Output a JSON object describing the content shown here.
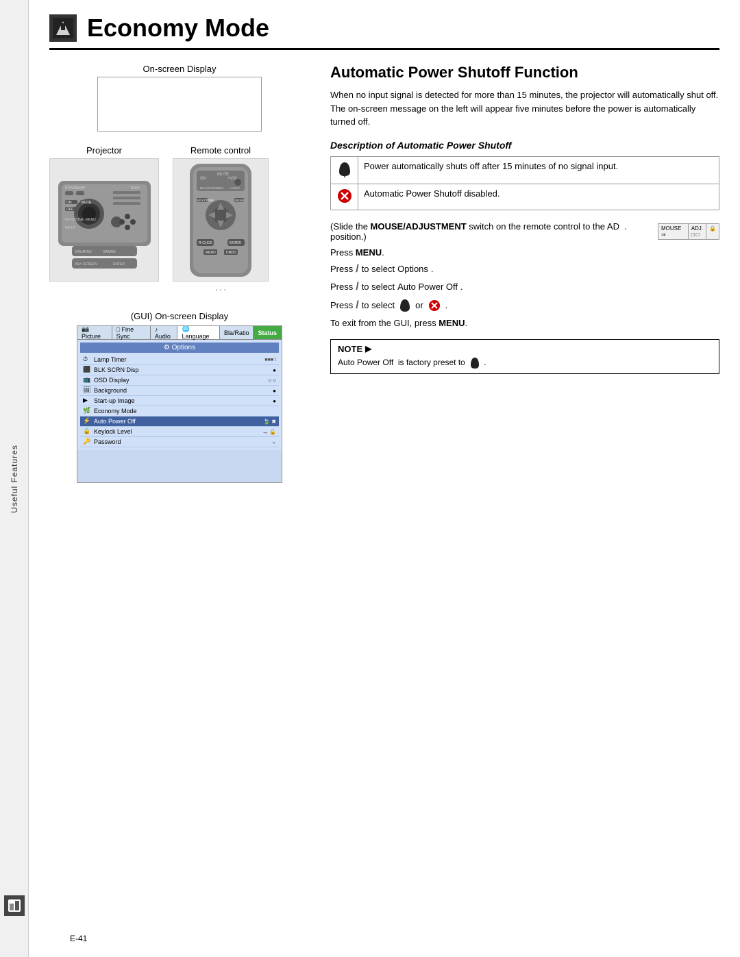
{
  "sidebar": {
    "label": "Useful Features",
    "icon": "★"
  },
  "header": {
    "title": "Economy Mode",
    "icon": "■"
  },
  "left": {
    "display_label": "On-screen Display",
    "projector_label": "Projector",
    "remote_label": "Remote control",
    "gui_label": "(GUI) On-screen Display",
    "gui_tabs": [
      "Picture",
      "Fine Sync",
      "Audio",
      "Language",
      "Bla/Ratio",
      "Status"
    ],
    "gui_menu_title": "Options",
    "gui_items": [
      {
        "icon": "lamp",
        "text": "Lamp Timer",
        "val": ""
      },
      {
        "icon": "flk",
        "text": "BLK SCRN Disp",
        "val": "●"
      },
      {
        "icon": "osd",
        "text": "OSD Display",
        "val": "○ ○"
      },
      {
        "icon": "bg",
        "text": "Background",
        "val": "●"
      },
      {
        "icon": "startup",
        "text": "Start-up Image",
        "val": "●"
      },
      {
        "icon": "econ",
        "text": "Economy Mode",
        "val": ""
      },
      {
        "icon": "autopow",
        "text": "Auto Power Off",
        "val": "selected",
        "selected": true
      },
      {
        "icon": "key",
        "text": "Keylock Level",
        "val": "→"
      },
      {
        "icon": "pwd",
        "text": "Password",
        "val": "→"
      }
    ]
  },
  "right": {
    "section_title": "Automatic Power Shutoff Function",
    "section_desc": "When no input signal is detected for more than 15 minutes, the projector will automatically shut off. The on-screen message on the left will appear five minutes before the power is automatically turned off.",
    "subsection_title": "Description of Automatic Power Shutoff",
    "table_rows": [
      {
        "icon": "leaf",
        "text": "Power automatically shuts off after 15 minutes of no signal input."
      },
      {
        "icon": "x",
        "text": "Automatic Power Shutoff disabled."
      }
    ],
    "mouse_adj_line": "(Slide the MOUSE/ADJUSTMENT switch on the remote control to the AD . position.)",
    "mouse_label": "MOUSE",
    "adj_label": "ADJ.",
    "press_menu": "Press MENU.",
    "steps": [
      "Press  /  to select  Options  .",
      "Press  /  to select  Auto Power Off  .",
      "Press  /  to select     or     ."
    ],
    "exit_line": "To exit from the GUI, press MENU.",
    "note_header": "NOTE",
    "note_text": "Auto Power Off  is factory preset to    ."
  },
  "footer": {
    "page": "E-41"
  }
}
